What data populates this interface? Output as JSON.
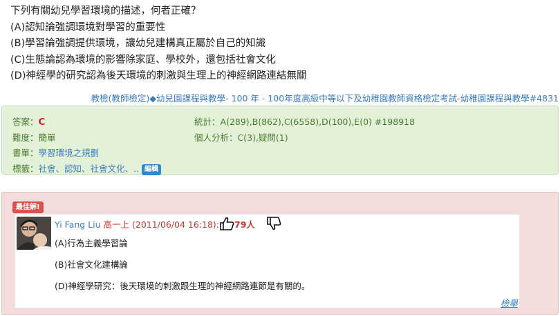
{
  "question": {
    "stem": "下列有關幼兒學習環境的描述，何者正確？",
    "options": [
      "(A)認知論強調環境對學習的重要性",
      "(B)學習論強調提供環境，讓幼兒建構真正屬於自己的知識",
      "(C)生態論認為環境的影響除家庭、學校外，還包括社會文化",
      "(D)神經學的研究認為後天環境的刺激與生理上的神經網路連結無關"
    ]
  },
  "source": {
    "category": "教檢(教師檢定)",
    "separator": "◆",
    "subject": "幼兒園課程與教學",
    "rest": "- 100 年 - 100年度高級中等以下及幼稚園教師資格檢定考試-幼稚園課程與教學#4831"
  },
  "info": {
    "answer_label": "答案：",
    "answer_value": "C",
    "difficulty_label": "難度：",
    "difficulty_value": "簡單",
    "book_label": "書單：",
    "book_value": "學習環境之規劃",
    "tags_label": "標籤：",
    "tags_value": "社會、認知、社會文化、..",
    "edit_label": "編輯",
    "stats_label": "統計：",
    "stats_value": "A(289),B(862),C(6558),D(100),E(0) #198918",
    "personal_label": "個人分析：",
    "personal_value": "C(3),疑問(1)"
  },
  "best_answer": {
    "badge": "最佳解!",
    "user_name": "Yi Fang Liu",
    "user_meta": "高一上 (2011/06/04 16:18):",
    "likes": "79人",
    "lines": [
      "(A)行為主義學習論",
      "(B)社會文化建構論",
      "(D)神經學研究：後天環境的刺激跟生理的神經網路連節是有關的。"
    ],
    "report_label": "檢舉"
  },
  "colors": {
    "link": "#3b7bbd",
    "answer_red": "#d9231d",
    "info_bg": "#e2f1d8",
    "answer_bg": "#f2dcdc",
    "badge_red": "#d9534f"
  },
  "icons": {
    "like": "thumbs-up-icon",
    "dislike": "thumbs-down-icon"
  }
}
